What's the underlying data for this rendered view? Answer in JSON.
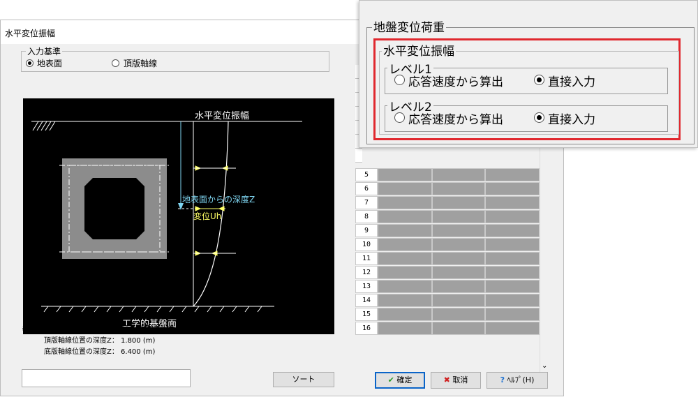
{
  "window": {
    "title": "水平変位振幅"
  },
  "input_basis": {
    "legend": "入力基準",
    "options": [
      {
        "label": "地表面",
        "selected": true
      },
      {
        "label": "頂版軸線",
        "selected": false
      }
    ]
  },
  "figure": {
    "title": "水平変位振幅",
    "depth_label": "地表面からの深度Z",
    "disp_label": "変位Uh",
    "base_label": "工学的基盤面",
    "colors": {
      "depth": "#7fd6f2",
      "disp": "#ffff66",
      "struct": "#8c8c8c"
    }
  },
  "notes": {
    "line1": "※頂版軸線以浅、底版軸線以深の変位は必ず入力してください。",
    "line2": "頂版軸線位置の深度Z： 1.800 (m)",
    "line3": "底版軸線位置の深度Z： 6.400 (m)"
  },
  "grid": {
    "rows": [
      "5",
      "6",
      "7",
      "8",
      "9",
      "10",
      "11",
      "12",
      "13",
      "14",
      "15",
      "16"
    ]
  },
  "buttons": {
    "sort": "ソート",
    "ok": "確定",
    "cancel": "取消",
    "help": "ﾍﾙﾌﾟ(H)"
  },
  "popup": {
    "title": "地盤変位荷重",
    "group": "水平変位振幅",
    "level1": {
      "legend": "レベル1",
      "opt_calc": "応答速度から算出",
      "opt_direct": "直接入力",
      "selected": "direct"
    },
    "level2": {
      "legend": "レベル2",
      "opt_calc": "応答速度から算出",
      "opt_direct": "直接入力",
      "selected": "direct"
    },
    "highlight_color": "#e0282e"
  }
}
